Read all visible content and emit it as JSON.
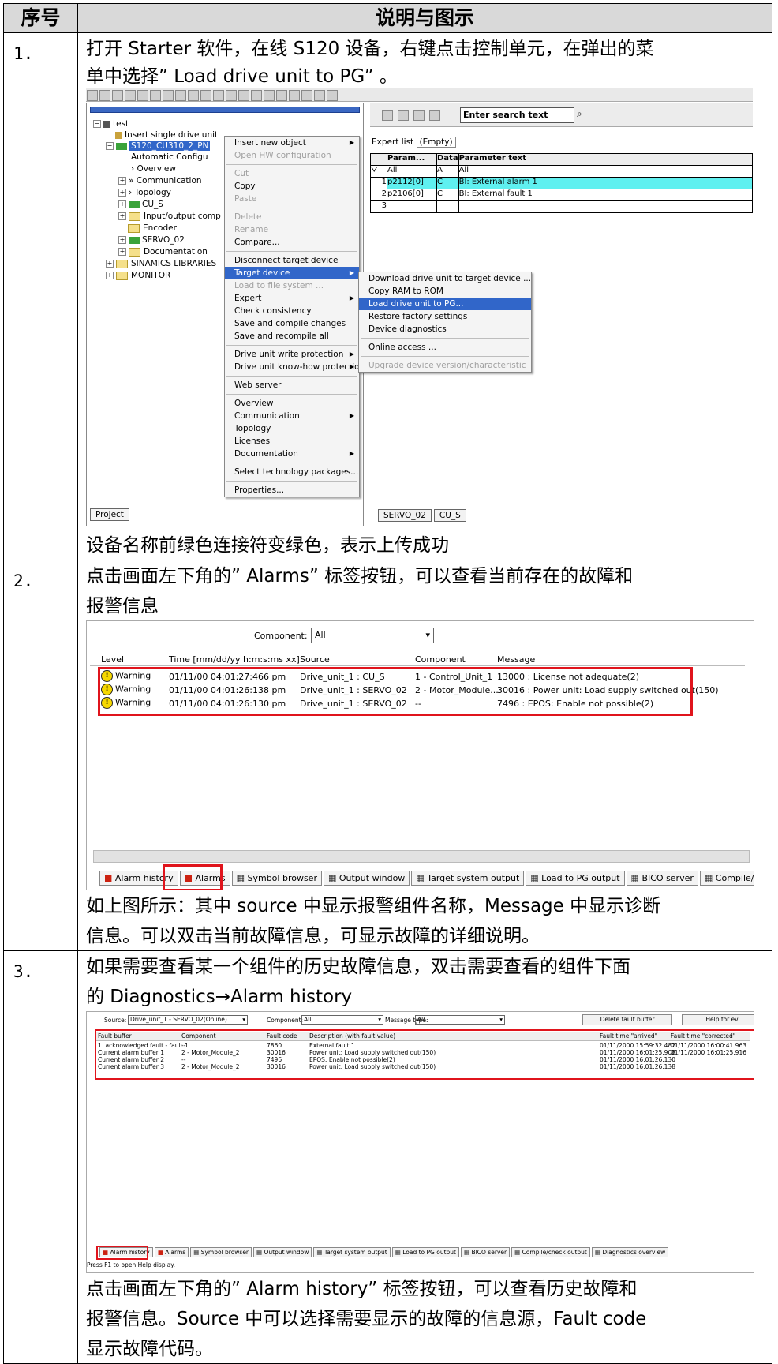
{
  "table": {
    "header_num": "序号",
    "header_desc": "说明与图示",
    "rows": [
      {
        "num": "1.",
        "text_a": "打开 Starter 软件，在线 S120 设备，右键点击控制单元，在弹出的菜",
        "text_b": "单中选择” Load drive unit to PG” 。",
        "text_c": "设备名称前绿色连接符变绿色，表示上传成功"
      },
      {
        "num": "2.",
        "text_a": "点击画面左下角的” Alarms” 标签按钮，可以查看当前存在的故障和",
        "text_b": "报警信息",
        "text_c": "如上图所示：其中 source 中显示报警组件名称，Message 中显示诊断",
        "text_d": "信息。可以双击当前故障信息，可显示故障的详细说明。"
      },
      {
        "num": "3.",
        "text_a": "如果需要查看某一个组件的历史故障信息，双击需要查看的组件下面",
        "text_b": "的 Diagnostics→Alarm history",
        "text_c": "点击画面左下角的” Alarm history” 标签按钮，可以查看历史故障和",
        "text_d": "报警信息。Source 中可以选择需要显示的故障的信息源，Fault code",
        "text_e": "显示故障代码。"
      }
    ]
  },
  "shot1": {
    "tree": [
      "test",
      "Insert single drive unit",
      "S120_CU310_2_PN",
      "Automatic Configu",
      "Overview",
      "Communication",
      "Topology",
      "CU_S",
      "Input/output comp",
      "Encoder",
      "SERVO_02",
      "Documentation",
      "SINAMICS LIBRARIES",
      "MONITOR"
    ],
    "project_tab": "Project",
    "context_menu": [
      {
        "label": "Insert new object",
        "state": "normal",
        "sub": true
      },
      {
        "label": "Open HW configuration",
        "state": "dis"
      },
      {
        "sep": true
      },
      {
        "label": "Cut",
        "state": "dis"
      },
      {
        "label": "Copy",
        "state": "normal"
      },
      {
        "label": "Paste",
        "state": "dis"
      },
      {
        "sep": true
      },
      {
        "label": "Delete",
        "state": "dis"
      },
      {
        "label": "Rename",
        "state": "dis"
      },
      {
        "label": "Compare...",
        "state": "normal"
      },
      {
        "sep": true
      },
      {
        "label": "Disconnect target device",
        "state": "normal"
      },
      {
        "label": "Target device",
        "state": "sel",
        "sub": true
      },
      {
        "label": "Load to file system ...",
        "state": "dis"
      },
      {
        "label": "Expert",
        "state": "normal",
        "sub": true
      },
      {
        "label": "Check consistency",
        "state": "normal"
      },
      {
        "label": "Save and compile changes",
        "state": "normal"
      },
      {
        "label": "Save and recompile all",
        "state": "normal"
      },
      {
        "sep": true
      },
      {
        "label": "Drive unit write protection",
        "state": "normal",
        "sub": true
      },
      {
        "label": "Drive unit know-how protection",
        "state": "normal",
        "sub": true
      },
      {
        "sep": true
      },
      {
        "label": "Web server",
        "state": "normal"
      },
      {
        "sep": true
      },
      {
        "label": "Overview",
        "state": "normal"
      },
      {
        "label": "Communication",
        "state": "normal",
        "sub": true
      },
      {
        "label": "Topology",
        "state": "normal"
      },
      {
        "label": "Licenses",
        "state": "normal"
      },
      {
        "label": "Documentation",
        "state": "normal",
        "sub": true
      },
      {
        "sep": true
      },
      {
        "label": "Select technology packages...",
        "state": "normal"
      },
      {
        "sep": true
      },
      {
        "label": "Properties...",
        "state": "normal"
      }
    ],
    "submenu": [
      {
        "label": "Download drive unit to target device ...",
        "state": "normal"
      },
      {
        "label": "Copy RAM to ROM",
        "state": "normal"
      },
      {
        "label": "Load drive unit to PG...",
        "state": "sel"
      },
      {
        "label": "Restore factory settings",
        "state": "normal"
      },
      {
        "label": "Device diagnostics",
        "state": "normal"
      },
      {
        "sep": true
      },
      {
        "label": "Online access ...",
        "state": "normal"
      },
      {
        "sep": true
      },
      {
        "label": "Upgrade device version/characteristic",
        "state": "dis"
      }
    ],
    "search_placeholder": "Enter search text",
    "expert_list": "Expert list",
    "empty": "(Empty)",
    "cols": [
      "Param...",
      "Data",
      "Parameter text"
    ],
    "filter": [
      "All",
      "A",
      "All"
    ],
    "params": [
      {
        "n": "1",
        "p": "p2112[0]",
        "d": "C",
        "t": "BI: External alarm 1"
      },
      {
        "n": "2",
        "p": "p2106[0]",
        "d": "C",
        "t": "BI: External fault 1"
      },
      {
        "n": "3",
        "p": "",
        "d": "",
        "t": ""
      }
    ],
    "tabs": [
      "SERVO_02",
      "CU_S"
    ]
  },
  "shot2": {
    "component_label": "Component:",
    "component_value": "All",
    "cols": [
      "Level",
      "Time [mm/dd/yy  h:m:s:ms xx]",
      "Source",
      "Component",
      "Message"
    ],
    "rows": [
      {
        "level": "Warning",
        "time": "01/11/00  04:01:27:466 pm",
        "source": "Drive_unit_1 : CU_S",
        "comp": "1 - Control_Unit_1",
        "msg": "13000 : License not adequate(2)"
      },
      {
        "level": "Warning",
        "time": "01/11/00  04:01:26:138 pm",
        "source": "Drive_unit_1 : SERVO_02",
        "comp": "2 - Motor_Module...",
        "msg": "30016 : Power unit: Load supply switched out(150)"
      },
      {
        "level": "Warning",
        "time": "01/11/00  04:01:26:130 pm",
        "source": "Drive_unit_1 : SERVO_02",
        "comp": "--",
        "msg": "7496 : EPOS: Enable not possible(2)"
      }
    ],
    "tabs": [
      "Alarm history",
      "Alarms",
      "Symbol browser",
      "Output window",
      "Target system output",
      "Load to PG output",
      "BICO server",
      "Compile/che"
    ]
  },
  "shot3": {
    "source_label": "Source:",
    "source_value": "Drive_unit_1 - SERVO_02(Online)",
    "component_label": "Component:",
    "component_value": "All",
    "msgtype_label": "Message type:",
    "msgtype_value": "All",
    "delete_btn": "Delete fault buffer",
    "help_btn": "Help for ev",
    "cols": [
      "Fault buffer",
      "Component",
      "Fault code",
      "Description (with fault value)",
      "Fault time \"arrived\"",
      "Fault time \"corrected\""
    ],
    "rows": [
      {
        "buf": "1. acknowledged fault - fault 1",
        "comp": "--",
        "code": "7860",
        "desc": "External fault 1",
        "arr": "01/11/2000 15:59:32.482",
        "cor": "01/11/2000 16:00:41.963"
      },
      {
        "buf": "Current alarm buffer 1",
        "comp": "2 - Motor_Module_2",
        "code": "30016",
        "desc": "Power unit: Load supply switched out(150)",
        "arr": "01/11/2000 16:01:25.908",
        "cor": "01/11/2000 16:01:25.916"
      },
      {
        "buf": "Current alarm buffer 2",
        "comp": "--",
        "code": "7496",
        "desc": "EPOS: Enable not possible(2)",
        "arr": "01/11/2000 16:01:26.130",
        "cor": "-"
      },
      {
        "buf": "Current alarm buffer 3",
        "comp": "2 - Motor_Module_2",
        "code": "30016",
        "desc": "Power unit: Load supply switched out(150)",
        "arr": "01/11/2000 16:01:26.138",
        "cor": "-"
      }
    ],
    "tabs": [
      "Alarm history",
      "Alarms",
      "Symbol browser",
      "Output window",
      "Target system output",
      "Load to PG output",
      "BICO server",
      "Compile/check output",
      "Diagnostics overview"
    ],
    "status": "Press F1 to open Help display."
  },
  "colors": {
    "highlight_blue": "#3166c9",
    "red_frame": "#e0141c",
    "cyan": "#5ff0f0",
    "green": "#3aa33a"
  }
}
